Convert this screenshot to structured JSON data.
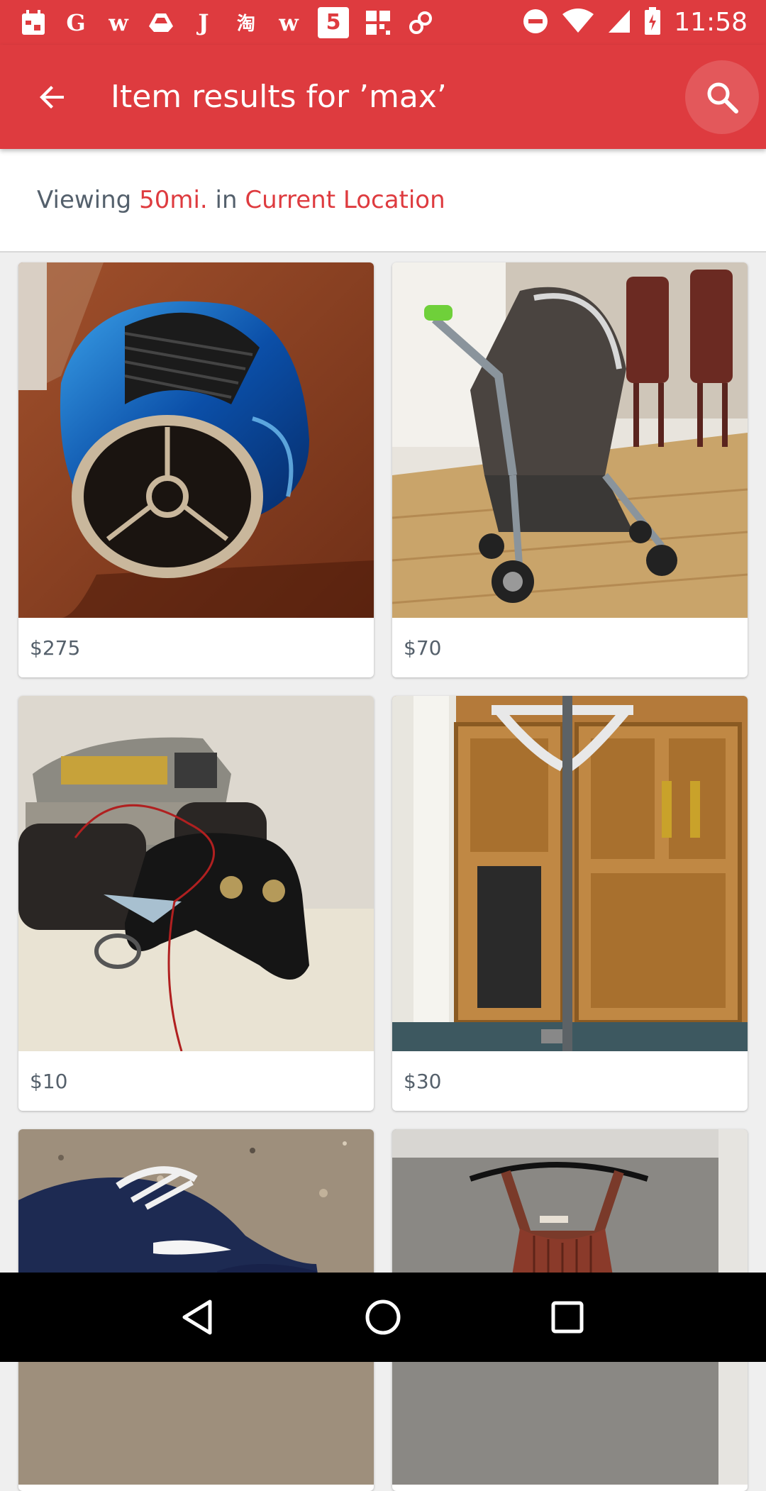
{
  "status_bar": {
    "time": "11:58",
    "notification_icons": [
      "G",
      "w",
      "J",
      "淘",
      "w",
      "5",
      "⊞"
    ]
  },
  "app_bar": {
    "title": "Item results for ’max’"
  },
  "location": {
    "prefix": "Viewing ",
    "distance": "50mi.",
    "middle": " in ",
    "place": "Current Location"
  },
  "items": [
    {
      "price": "$275",
      "image": "blue-hoverboard"
    },
    {
      "price": "$70",
      "image": "gray-stroller"
    },
    {
      "price": "$10",
      "image": "rc-monster-truck-and-controller"
    },
    {
      "price": "$30",
      "image": "crutch-by-wooden-door"
    },
    {
      "price": "",
      "image": "navy-sneaker"
    },
    {
      "price": "",
      "image": "brown-dress-on-hanger"
    }
  ],
  "colors": {
    "brand_red": "#de3b3f",
    "text_gray": "#55606b"
  }
}
